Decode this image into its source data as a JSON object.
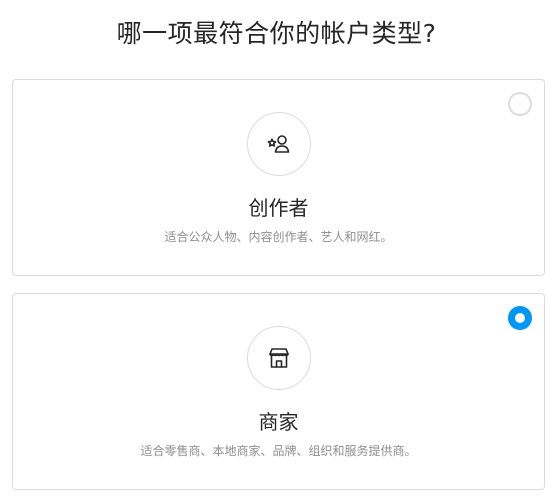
{
  "page": {
    "title": "哪一项最符合你的帐户类型?"
  },
  "options": [
    {
      "id": "creator",
      "title": "创作者",
      "description": "适合公众人物、内容创作者、艺人和网红。",
      "icon": "creator-star-person-icon",
      "selected": false
    },
    {
      "id": "business",
      "title": "商家",
      "description": "适合零售商、本地商家、品牌、组织和服务提供商。",
      "icon": "storefront-icon",
      "selected": true
    }
  ],
  "colors": {
    "accent": "#0095f6",
    "border": "#dbdbdb",
    "text_primary": "#262626",
    "text_secondary": "#8e8e8e"
  }
}
